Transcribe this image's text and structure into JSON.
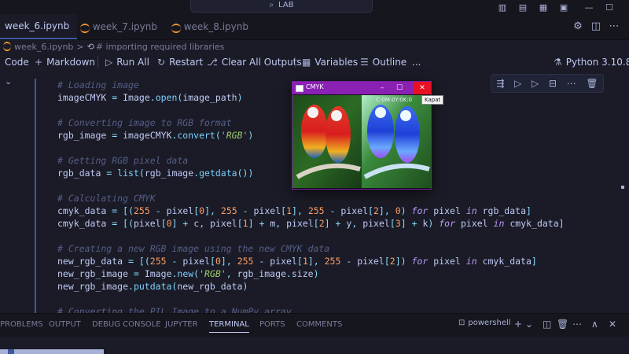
{
  "titlebar": {
    "search_text": "LAB"
  },
  "tabs": [
    {
      "label": "week_6.ipynb"
    },
    {
      "label": "week_7.ipynb"
    },
    {
      "label": "week_8.ipynb"
    }
  ],
  "breadcrumb": {
    "file": "week_6.ipynb",
    "separator": ">",
    "section": "# importing required libraries"
  },
  "toolbar": {
    "code_label": "Code",
    "markdown_label": "Markdown",
    "run_all_label": "Run All",
    "restart_label": "Restart",
    "clear_outputs_label": "Clear All Outputs",
    "variables_label": "Variables",
    "outline_label": "Outline",
    "more_label": "...",
    "kernel_label": "Python 3.10.8"
  },
  "code_lines": [
    "# Loading image",
    "imageCMYK = Image.open(image_path)",
    "",
    "# Converting image to RGB format",
    "rgb_image = imageCMYK.convert('RGB')",
    "",
    "# Getting RGB pixel data",
    "rgb_data = list(rgb_image.getdata())",
    "",
    "# Calculating CMYK",
    "cmyk_data = [(255 - pixel[0], 255 - pixel[1], 255 - pixel[2], 0) for pixel in rgb_data]",
    "cmyk_data = [(pixel[0] + c, pixel[1] + m, pixel[2] + y, pixel[3] + k) for pixel in cmyk_data]",
    "",
    "# Creating a new RGB image using the new CMYK data",
    "new_rgb_data = [(255 - pixel[0], 255 - pixel[1], 255 - pixel[2]) for pixel in cmyk_data]",
    "new_rgb_image = Image.new('RGB', rgb_image.size)",
    "new_rgb_image.putdata(new_rgb_data)",
    "",
    "# Converting the PIL Image to a NumPy array"
  ],
  "cmyk_window": {
    "title": "CMYK",
    "coords": "C:0M:0Y:0K:0",
    "close_tooltip": "Kapat"
  },
  "panel": {
    "tabs": [
      "PROBLEMS",
      "OUTPUT",
      "DEBUG CONSOLE",
      "JUPYTER",
      "TERMINAL",
      "PORTS",
      "COMMENTS"
    ],
    "active_tab": "TERMINAL",
    "shell": "powershell"
  },
  "colors": {
    "accent": "#3d59a1",
    "window_titlebar": "#8b21b3",
    "close": "#e81123"
  }
}
